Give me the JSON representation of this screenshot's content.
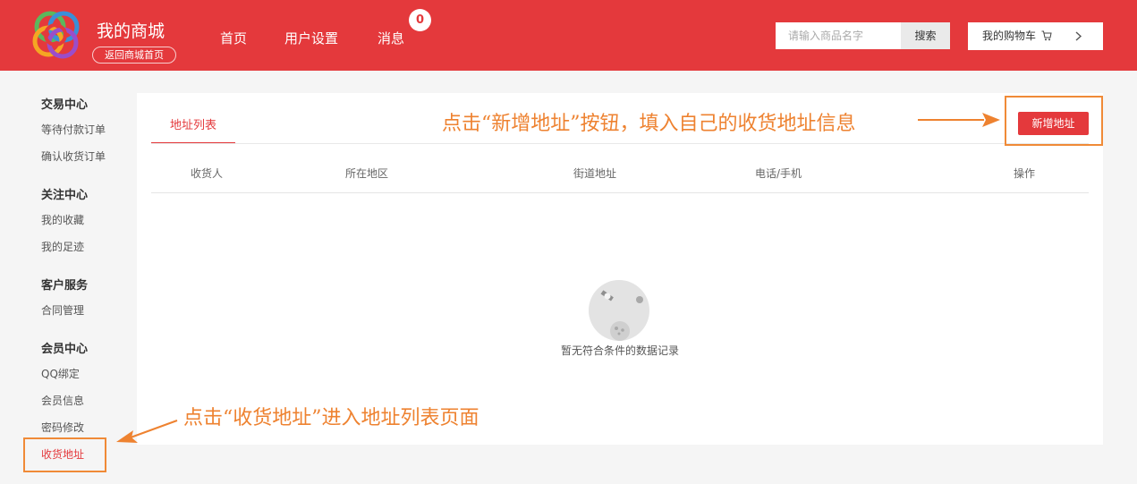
{
  "header": {
    "brand": "我的商城",
    "back_home": "返回商城首页",
    "nav": [
      "首页",
      "用户设置",
      "消息"
    ],
    "message_count": "0",
    "search_placeholder": "请输入商品名字",
    "search_button": "搜索",
    "cart_label": "我的购物车"
  },
  "sidebar": {
    "groups": [
      {
        "title": "交易中心",
        "items": [
          "等待付款订单",
          "确认收货订单"
        ]
      },
      {
        "title": "关注中心",
        "items": [
          "我的收藏",
          "我的足迹"
        ]
      },
      {
        "title": "客户服务",
        "items": [
          "合同管理"
        ]
      },
      {
        "title": "会员中心",
        "items": [
          "QQ绑定",
          "会员信息",
          "密码修改",
          "收货地址"
        ]
      }
    ],
    "active_item": "收货地址"
  },
  "main": {
    "tab_label": "地址列表",
    "add_button": "新增地址",
    "columns": [
      "收货人",
      "所在地区",
      "街道地址",
      "电话/手机",
      "操作"
    ],
    "empty_text": "暂无符合条件的数据记录"
  },
  "annotations": {
    "top": "点击“新增地址”按钮，填入自己的收货地址信息",
    "bottom": "点击“收货地址”进入地址列表页面"
  },
  "colors": {
    "brand_red": "#e4393c",
    "annotation_orange": "#ee8230"
  },
  "icons": [
    "logo-icon",
    "cart-icon",
    "chevron-right-icon",
    "empty-planet-icon"
  ]
}
